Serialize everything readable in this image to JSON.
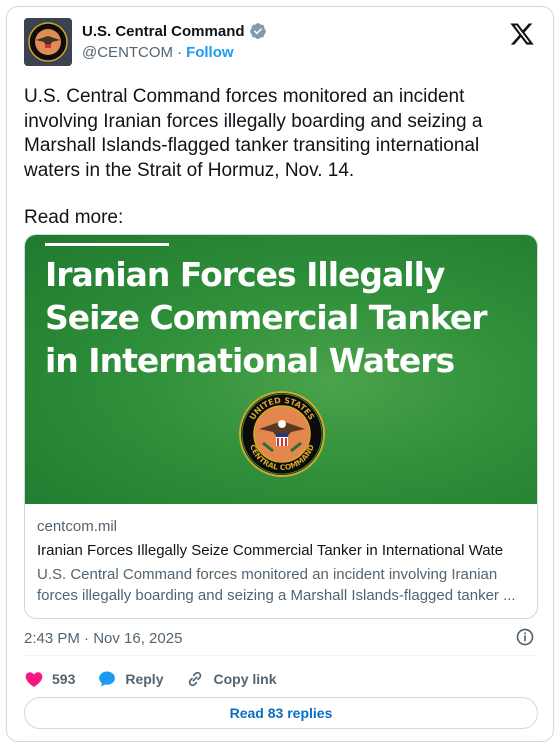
{
  "author": {
    "display_name": "U.S. Central Command",
    "handle": "@CENTCOM",
    "separator": "·",
    "follow_label": "Follow",
    "avatar_icon": "centcom-seal-icon",
    "verified_icon": "verified-badge-icon"
  },
  "platform_icon": "x-logo-icon",
  "tweet": {
    "text": "U.S. Central Command forces monitored an incident involving Iranian forces illegally boarding and seizing a Marshall Islands-flagged tanker transiting international waters in the Strait of Hormuz, Nov. 14.",
    "read_more": "Read more:"
  },
  "link_card": {
    "image_headline_lines": [
      "Iranian Forces Illegally",
      "Seize Commercial Tanker",
      "in International Waters"
    ],
    "seal_top_text": "UNITED STATES",
    "seal_bottom_text": "CENTRAL COMMAND",
    "domain": "centcom.mil",
    "title": "Iranian Forces Illegally Seize Commercial Tanker in International Wate",
    "description": "U.S. Central Command forces monitored an incident involving Iranian forces illegally boarding and seizing a Marshall Islands-flagged tanker ..."
  },
  "meta": {
    "timestamp": "2:43 PM · Nov 16, 2025",
    "info_icon": "info-icon"
  },
  "actions": {
    "like_count": "593",
    "reply_label": "Reply",
    "copy_link_label": "Copy link",
    "read_replies_label": "Read 83 replies"
  },
  "colors": {
    "accent": "#1d9bf0",
    "like": "#f91880",
    "image_green": "#2f8f3a",
    "text_secondary": "#536471"
  }
}
